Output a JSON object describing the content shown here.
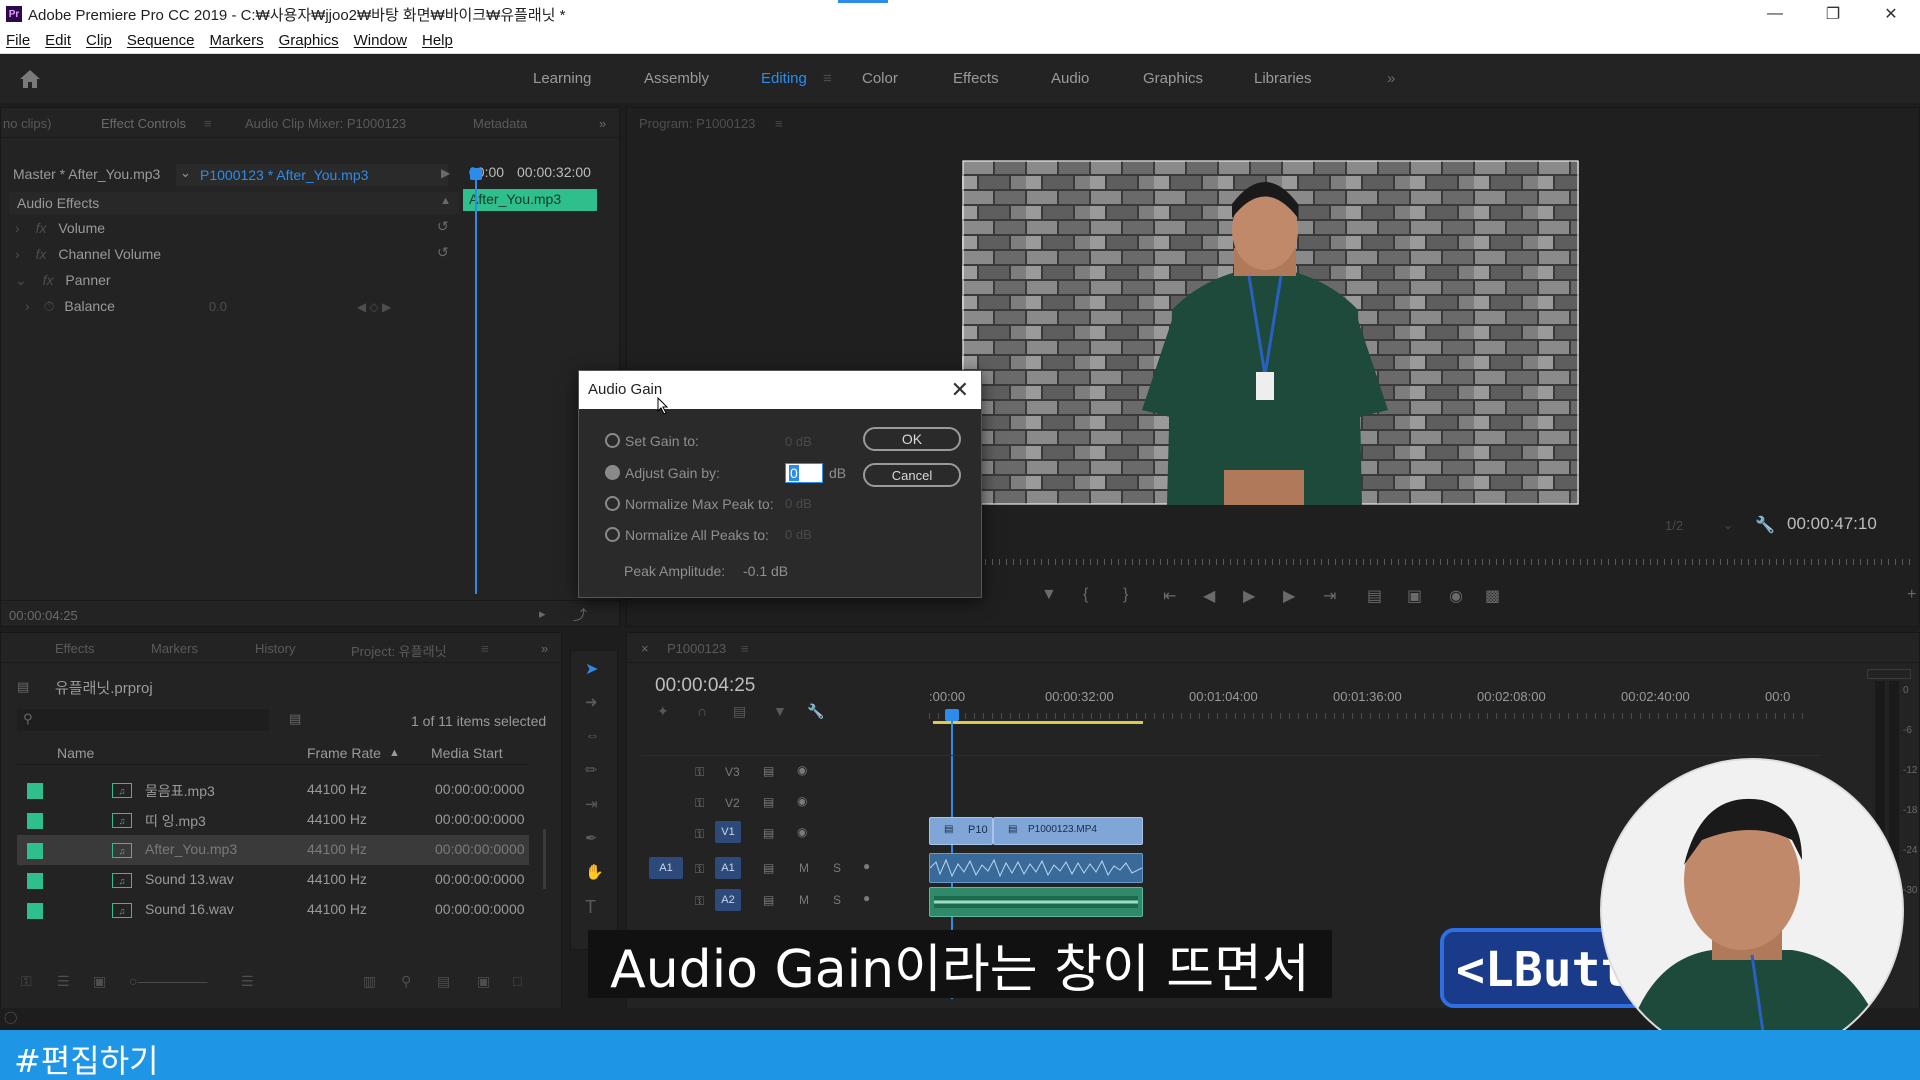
{
  "window": {
    "title": "Adobe Premiere Pro CC 2019 - C:₩사용자₩jjoo2₩바탕 화면₩바이크₩유플래닛 *",
    "app_badge": "Pr"
  },
  "menu": [
    "File",
    "Edit",
    "Clip",
    "Sequence",
    "Markers",
    "Graphics",
    "Window",
    "Help"
  ],
  "workspaces": {
    "tabs": [
      "Learning",
      "Assembly",
      "Editing",
      "Color",
      "Effects",
      "Audio",
      "Graphics",
      "Libraries"
    ],
    "active": "Editing",
    "overflow": "»"
  },
  "source_panel": {
    "tabs": [
      "no clips)",
      "Effect Controls",
      "Audio Clip Mixer: P1000123",
      "Metadata"
    ],
    "master_label": "Master * After_You.mp3",
    "clip_label": "P1000123 * After_You.mp3",
    "time_start": "00:00",
    "time_end": "00:00:32:00",
    "clip_bar": "After_You.mp3",
    "section": "Audio Effects",
    "effects": [
      "Volume",
      "Channel Volume",
      "Panner"
    ],
    "balance_label": "Balance",
    "balance_value": "0.0",
    "timecode": "00:00:04:25"
  },
  "program_monitor": {
    "title": "Program: P1000123",
    "resolution": "1/2",
    "duration": "00:00:47:10"
  },
  "dialog": {
    "title": "Audio Gain",
    "options": [
      {
        "label": "Set Gain to:",
        "value": "0 dB",
        "selected": false
      },
      {
        "label": "Adjust Gain by:",
        "value": "0",
        "unit": "dB",
        "selected": true
      },
      {
        "label": "Normalize Max Peak to:",
        "value": "0 dB",
        "selected": false
      },
      {
        "label": "Normalize All Peaks to:",
        "value": "0 dB",
        "selected": false
      }
    ],
    "peak_label": "Peak Amplitude:",
    "peak_value": "-0.1 dB",
    "ok": "OK",
    "cancel": "Cancel"
  },
  "project_panel": {
    "tabs": [
      "Effects",
      "Markers",
      "History",
      "Project: 유플래닛"
    ],
    "project_file": "유플래닛.prproj",
    "selection_info": "1 of 11 items selected",
    "columns": [
      "Name",
      "Frame Rate",
      "Media Start"
    ],
    "items": [
      {
        "name": "물음표.mp3",
        "rate": "44100 Hz",
        "start": "00:00:00:0000",
        "selected": false
      },
      {
        "name": "띠 잉.mp3",
        "rate": "44100 Hz",
        "start": "00:00:00:0000",
        "selected": false
      },
      {
        "name": "After_You.mp3",
        "rate": "44100 Hz",
        "start": "00:00:00:0000",
        "selected": true
      },
      {
        "name": "Sound 13.wav",
        "rate": "44100 Hz",
        "start": "00:00:00:0000",
        "selected": false
      },
      {
        "name": "Sound 16.wav",
        "rate": "44100 Hz",
        "start": "00:00:00:0000",
        "selected": false
      }
    ]
  },
  "timeline": {
    "sequence": "P1000123",
    "timecode": "00:00:04:25",
    "ruler": [
      ":00:00",
      "00:00:32:00",
      "00:01:04:00",
      "00:01:36:00",
      "00:02:08:00",
      "00:02:40:00",
      "00:0"
    ],
    "tracks": [
      "V3",
      "V2",
      "V1",
      "A1",
      "A2"
    ],
    "source_patch": "A1",
    "clip_labels": [
      "P10",
      "P1000123.MP4"
    ],
    "meter_ticks": [
      "0",
      "-6",
      "-12",
      "-18",
      "-24",
      "-30"
    ]
  },
  "overlay": {
    "subtitle": "Audio Gain이라는 창이 뜨면서",
    "hashtag": "#편집하기",
    "lbutton": "<LButt"
  },
  "colors": {
    "accent_blue": "#2d8ceb",
    "audio_green": "#2fbf8c",
    "hashtag_bar": "#1f95e6",
    "clip_video": "#7fa6d6",
    "clip_audio": "#3a6a9a"
  }
}
